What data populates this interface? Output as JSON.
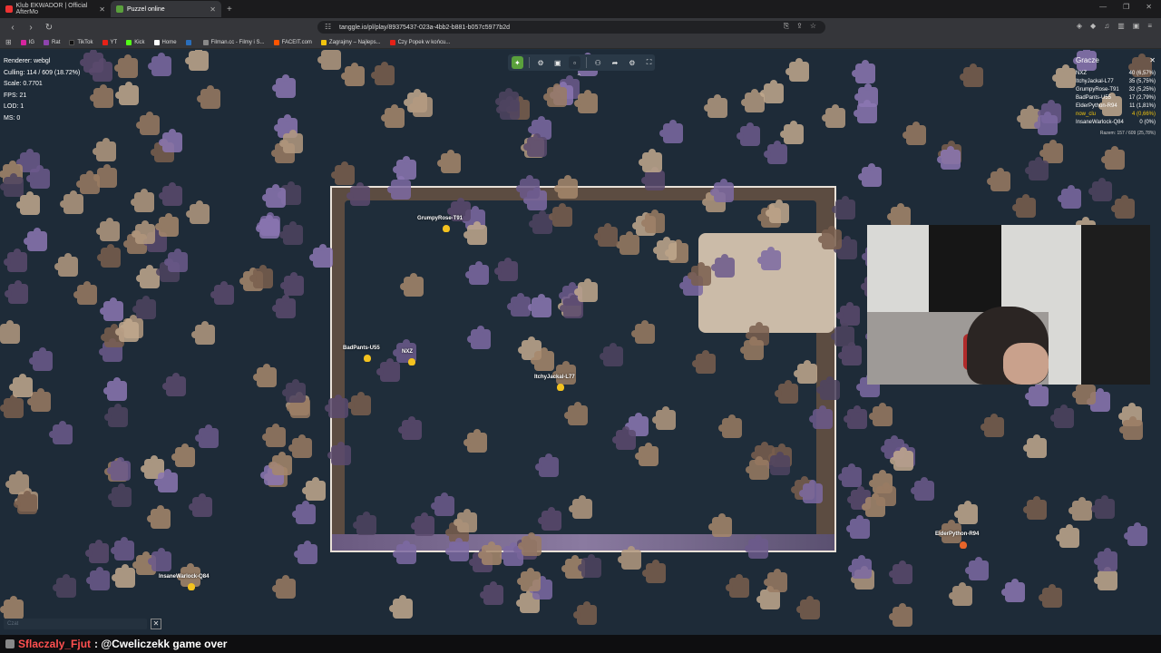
{
  "tabs": [
    {
      "label": "Klub EKWADOR | Official AfterMo",
      "active": false,
      "color": "#e33"
    },
    {
      "label": "Puzzel online",
      "active": true,
      "color": "#5aa03c"
    }
  ],
  "url": "tanggle.io/pl/play/89375437-023a-4bb2-b881-b057c5977b2d",
  "bookmarks": [
    {
      "label": "IG",
      "color": "#d6249f"
    },
    {
      "label": "Rat",
      "color": "#8e44ad"
    },
    {
      "label": "TikTok",
      "color": "#111111"
    },
    {
      "label": "YT",
      "color": "#e62117"
    },
    {
      "label": "Kick",
      "color": "#53fc18"
    },
    {
      "label": "Home",
      "color": "#ffffff"
    },
    {
      "label": "",
      "color": "#2a6ebb"
    },
    {
      "label": "Filman.cc - Filmy i S...",
      "color": "#888888"
    },
    {
      "label": "FACEIT.com",
      "color": "#ff5500"
    },
    {
      "label": "Zagrajmy – Najleps...",
      "color": "#f1c40f"
    },
    {
      "label": "Czy Popek w końcu...",
      "color": "#e62117"
    }
  ],
  "debug": {
    "renderer": "Renderer: webgl",
    "culling": "Culling: 114 / 609 (18.72%)",
    "scale": "Scale: 0.7701",
    "fps": "FPS: 21",
    "lod": "LOD: 1",
    "ms": "MS: 0"
  },
  "players": {
    "title": "Gracze",
    "list": [
      {
        "name": "NXZ",
        "score": "40 (6,57%)",
        "highlight": false
      },
      {
        "name": "ItchyJackal-L77",
        "score": "35 (5,75%)",
        "highlight": false
      },
      {
        "name": "GrumpyRose-T91",
        "score": "32 (5,25%)",
        "highlight": false
      },
      {
        "name": "BadPants-U55",
        "score": "17 (2,79%)",
        "highlight": false
      },
      {
        "name": "ElderPython-R94",
        "score": "11 (1,81%)",
        "highlight": false
      },
      {
        "name": "now_clu",
        "score": "4 (0,66%)",
        "highlight": true
      },
      {
        "name": "InsaneWarlock-Q84",
        "score": "0 (0%)",
        "highlight": false
      }
    ],
    "total": "Razem: 157 / 609 (25,78%)"
  },
  "cursors": {
    "grumpy": "GrumpyRose-T91",
    "badpants": "BadPants-U55",
    "nxz": "NXZ",
    "itchy": "ItchyJackal-L77",
    "elder": "ElderPython-R94",
    "insane": "InsaneWarlock-Q84"
  },
  "chat": {
    "placeholder": "Czat",
    "user": "Sflaczaly_Fjut",
    "message": ": @Cweliczekk game over"
  },
  "colors": {
    "background": "#1e2b38",
    "accent": "#5aa03c",
    "highlight": "#f1c40f"
  }
}
